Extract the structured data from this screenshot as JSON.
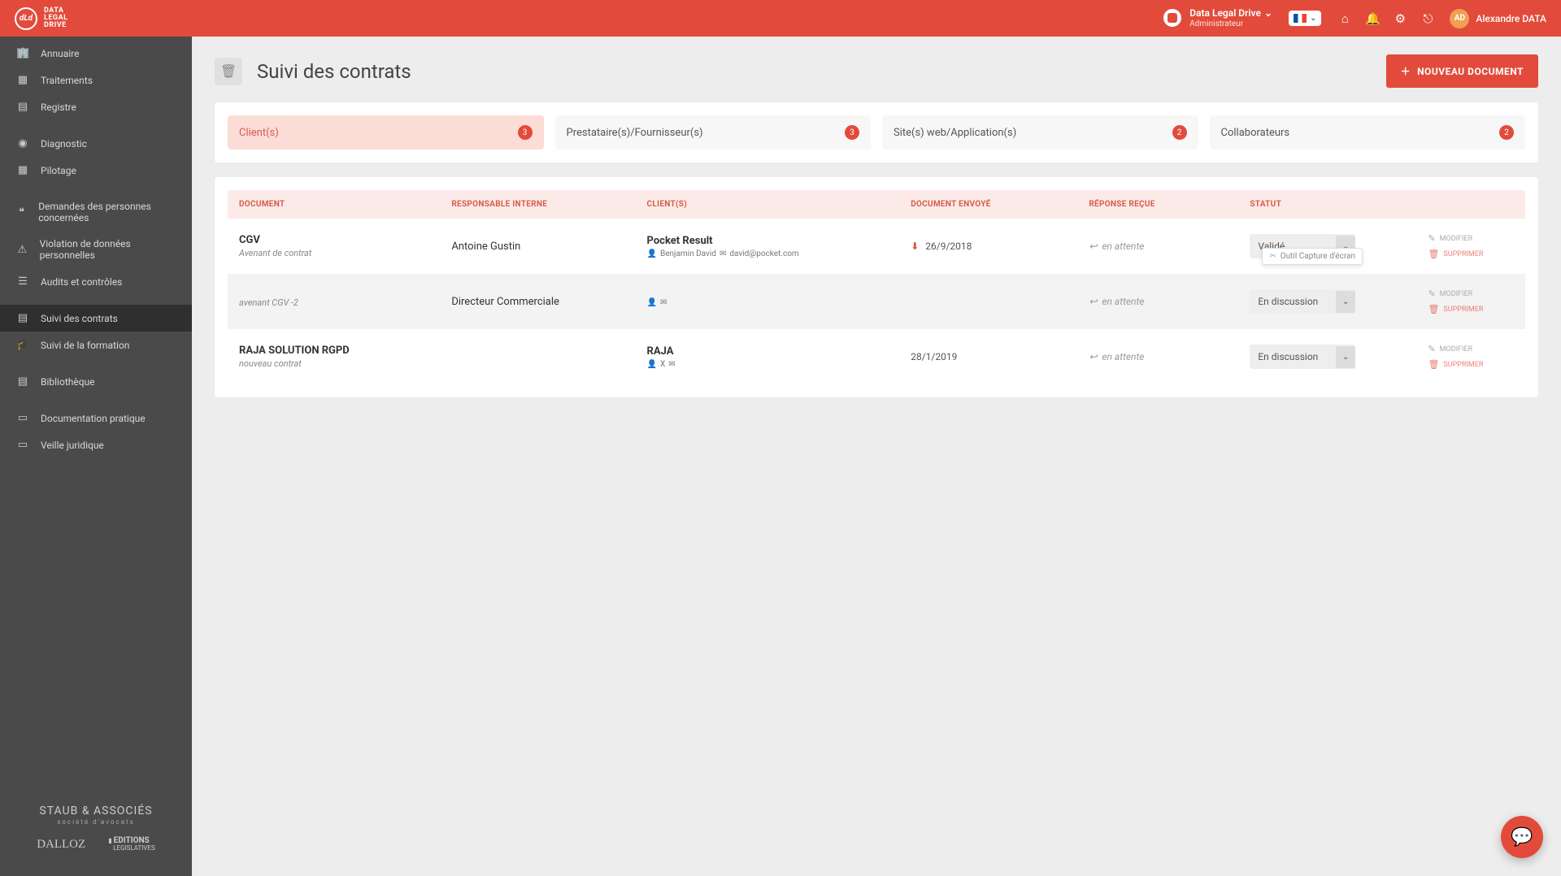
{
  "brand": "DATA LEGAL DRIVE",
  "header": {
    "org_name": "Data Legal Drive",
    "org_role": "Administrateur",
    "user_initials": "AD",
    "user_name": "Alexandre DATA"
  },
  "sidebar": {
    "items": [
      {
        "label": "Annuaire",
        "icon": "🏢"
      },
      {
        "label": "Traitements",
        "icon": "▦"
      },
      {
        "label": "Registre",
        "icon": "▤"
      },
      {
        "label": "Diagnostic",
        "icon": "◉"
      },
      {
        "label": "Pilotage",
        "icon": "▦"
      },
      {
        "label": "Demandes des personnes concernées",
        "icon": "❝"
      },
      {
        "label": "Violation de données personnelles",
        "icon": "⚠"
      },
      {
        "label": "Audits et contrôles",
        "icon": "☰"
      },
      {
        "label": "Suivi des contrats",
        "icon": "▤"
      },
      {
        "label": "Suivi de la formation",
        "icon": "🎓"
      },
      {
        "label": "Bibliothèque",
        "icon": "▤"
      },
      {
        "label": "Documentation pratique",
        "icon": "▭"
      },
      {
        "label": "Veille juridique",
        "icon": "▭"
      }
    ],
    "partners": {
      "p1": "STAUB & ASSOCIÉS",
      "p1_sub": "société d'avocats",
      "p2": "DALLOZ",
      "p3a": "EDITIONS",
      "p3b": "LEGISLATIVES"
    }
  },
  "page": {
    "title": "Suivi des contrats",
    "new_button": "NOUVEAU DOCUMENT"
  },
  "tabs": [
    {
      "label": "Client(s)",
      "count": "3",
      "active": true
    },
    {
      "label": "Prestataire(s)/Fournisseur(s)",
      "count": "3",
      "active": false
    },
    {
      "label": "Site(s) web/Application(s)",
      "count": "2",
      "active": false
    },
    {
      "label": "Collaborateurs",
      "count": "2",
      "active": false
    }
  ],
  "table": {
    "headers": {
      "document": "DOCUMENT",
      "responsable": "RESPONSABLE INTERNE",
      "client": "CLIENT(S)",
      "envoye": "DOCUMENT ENVOYÉ",
      "reponse": "RÉPONSE REÇUE",
      "statut": "STATUT"
    },
    "actions": {
      "edit": "MODIFIER",
      "delete": "SUPPRIMER"
    },
    "pending_label": "en attente",
    "tooltip": "Outil Capture d'écran",
    "rows": [
      {
        "doc_title": "CGV",
        "doc_sub": "Avenant de contrat",
        "responsable": "Antoine Gustin",
        "client_name": "Pocket Result",
        "client_contact": "Benjamin David",
        "client_email": "david@pocket.com",
        "sent_date": "26/9/2018",
        "status": "Validé"
      },
      {
        "doc_title": "",
        "doc_sub": "avenant CGV -2",
        "responsable": "Directeur Commerciale",
        "client_name": "",
        "client_contact": "",
        "client_email": "",
        "sent_date": "",
        "status": "En discussion"
      },
      {
        "doc_title": "RAJA SOLUTION RGPD",
        "doc_sub": "nouveau contrat",
        "responsable": "",
        "client_name": "RAJA",
        "client_contact": "X",
        "client_email": "",
        "sent_date": "28/1/2019",
        "status": "En discussion"
      }
    ]
  }
}
